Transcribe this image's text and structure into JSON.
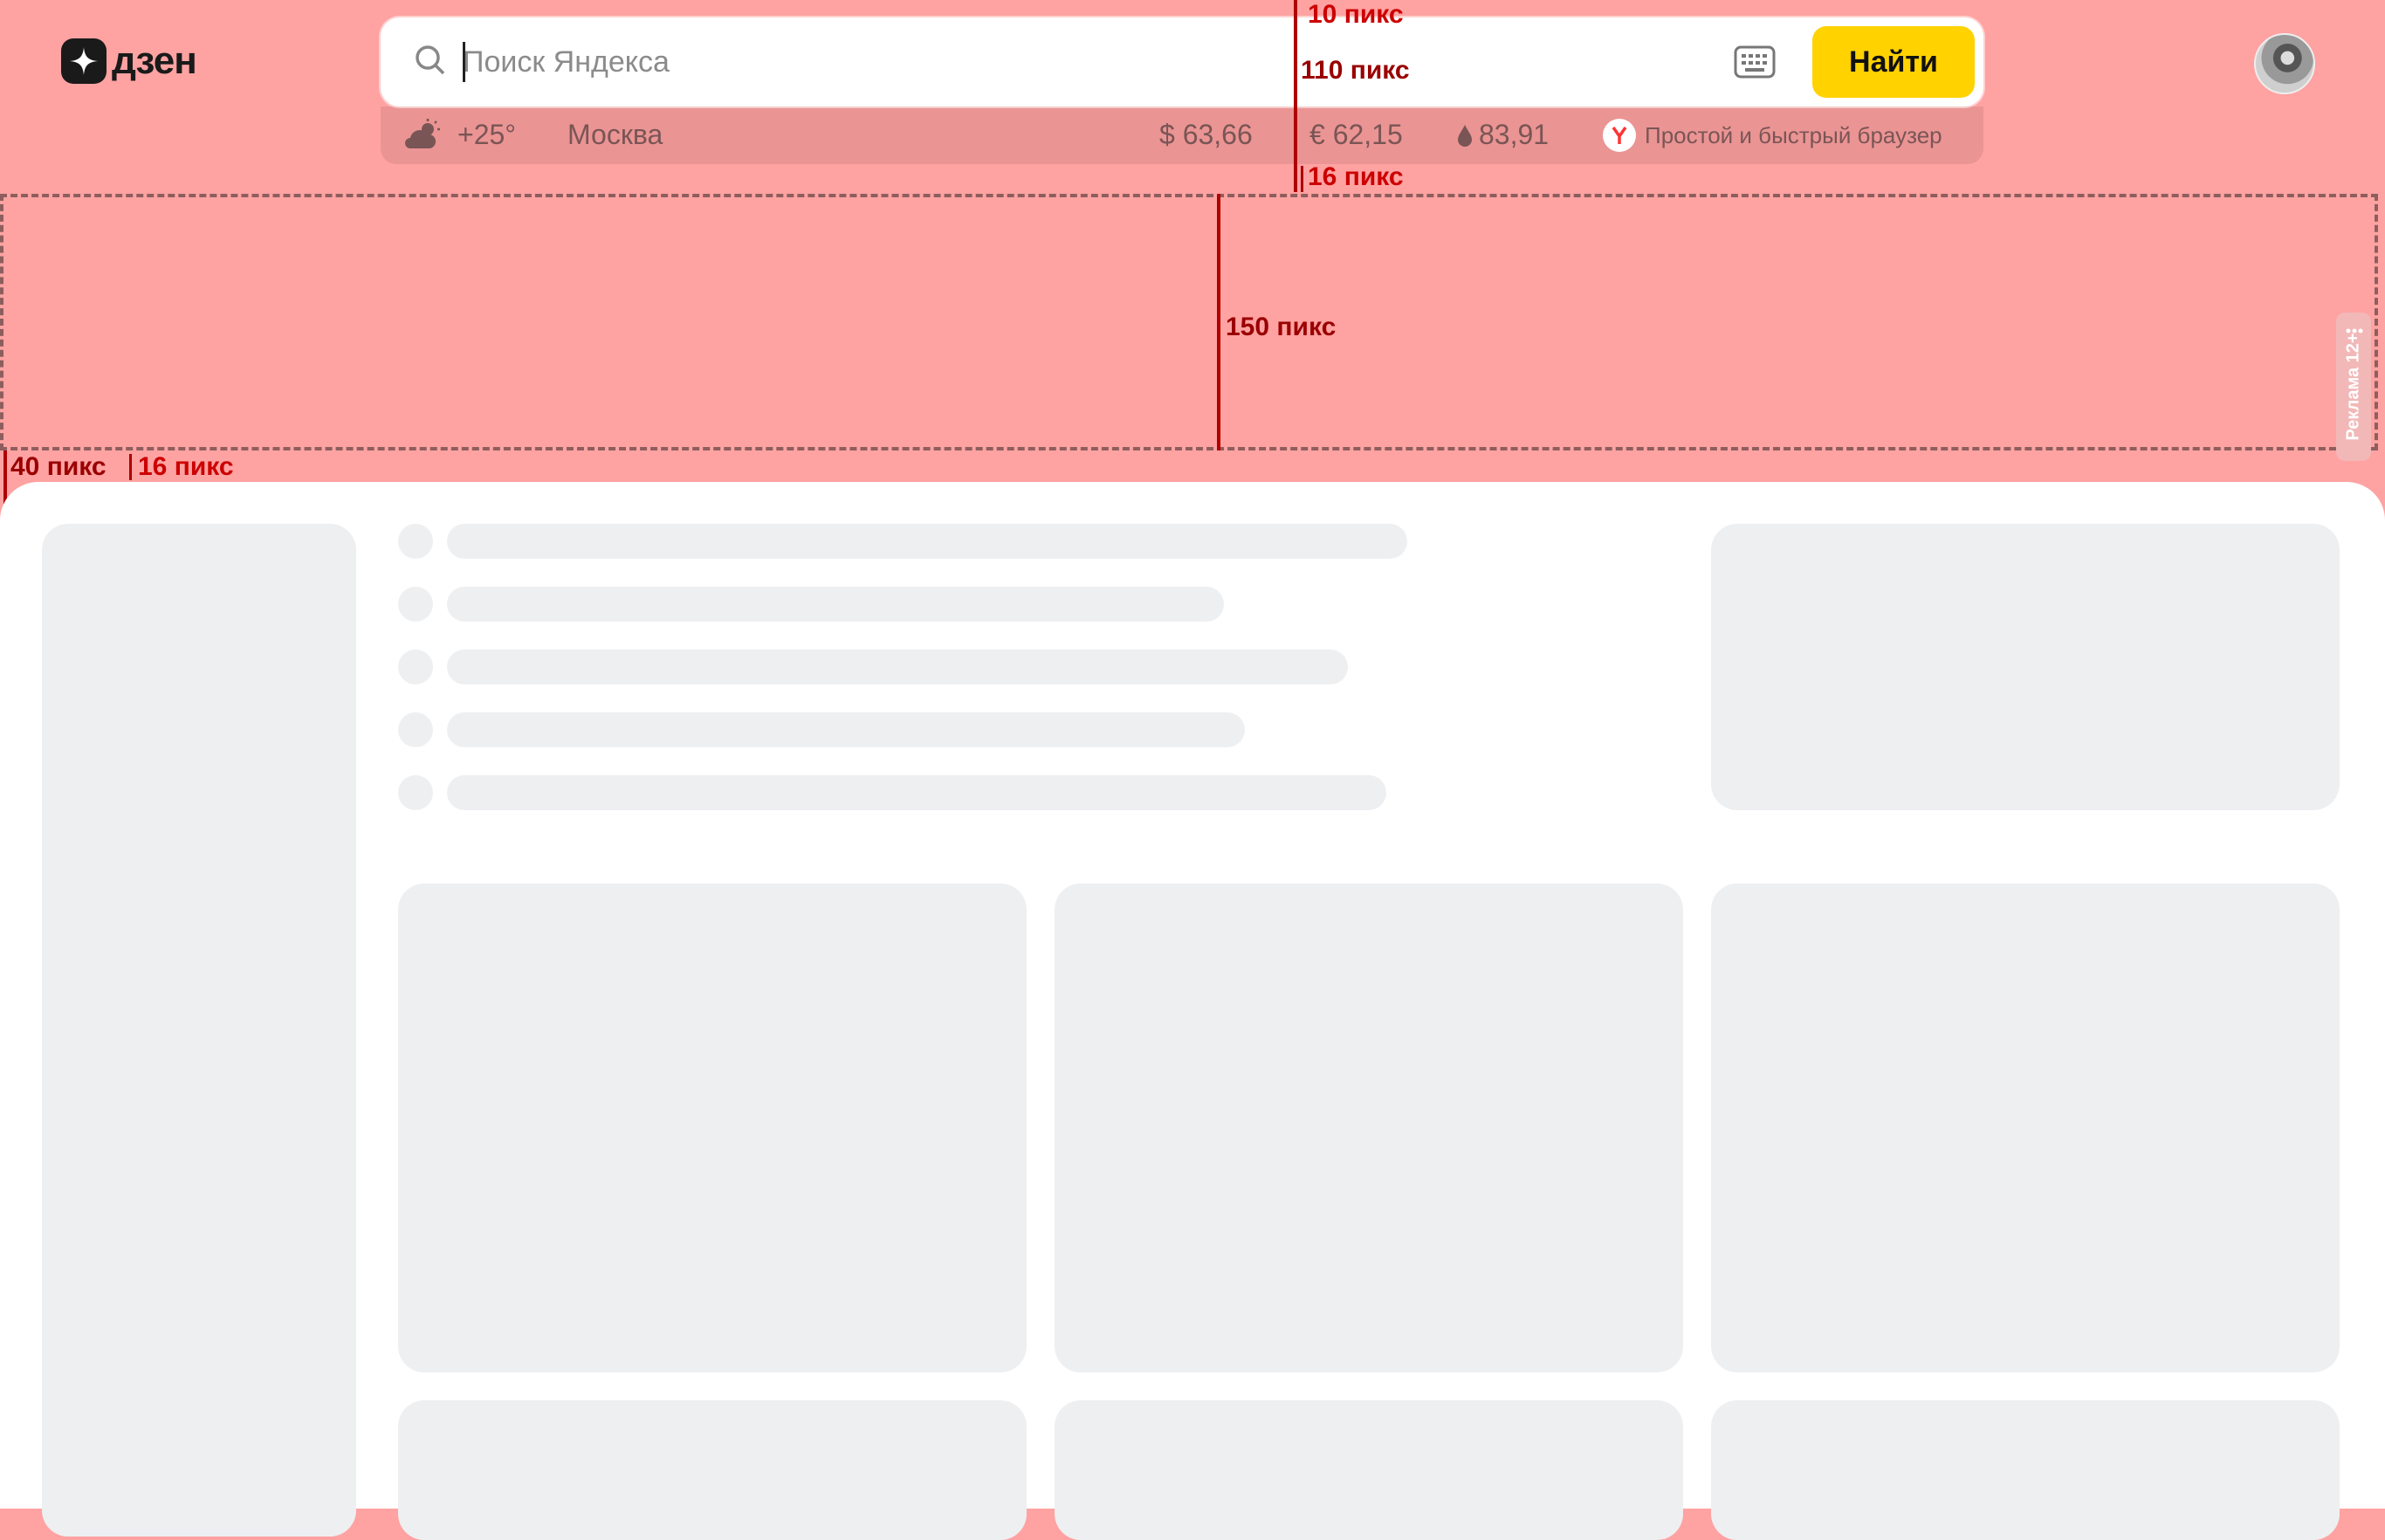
{
  "logo": {
    "text": "дзен",
    "icon": "zen-star-icon"
  },
  "search": {
    "placeholder": "Поиск Яндекса",
    "button_label": "Найти",
    "keyboard_icon": "keyboard-icon",
    "search_icon": "magnifier-icon"
  },
  "info": {
    "weather_icon": "cloud-sun-icon",
    "temperature": "+25°",
    "city": "Москва",
    "usd": "$ 63,66",
    "eur": "€ 62,15",
    "oil_icon": "oil-drop-icon",
    "oil": "83,91",
    "browser_promo": "Простой и быстрый браузер",
    "browser_icon": "yandex-browser-icon"
  },
  "ad": {
    "label": "Реклама 12+",
    "menu": "⋮"
  },
  "annotations": {
    "top_gap": "10 пикс",
    "search_height": "110 пикс",
    "bottom_gap": "16 пикс",
    "ad_height": "150 пикс",
    "left_margin": "40 пикс",
    "inner_gap": "16 пикс"
  },
  "colors": {
    "ad_zone": "#ffa2a2",
    "button": "#ffd200",
    "skeleton": "#eeeff1",
    "annotation": "#cc0000"
  }
}
